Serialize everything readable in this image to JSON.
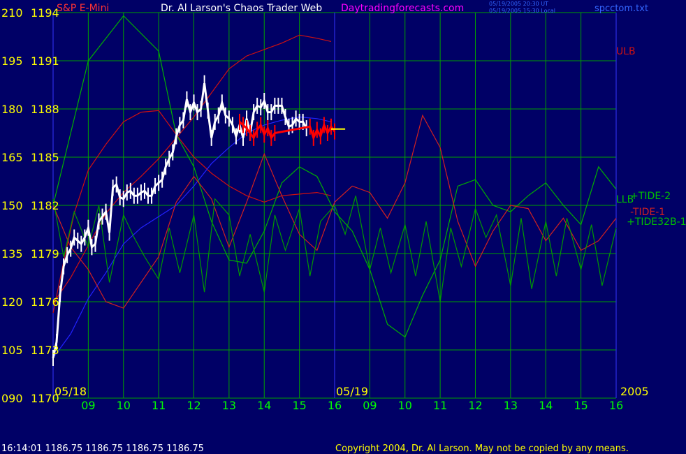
{
  "header": {
    "symbol": "S&P E-Mini",
    "title": "Dr. Al Larson's Chaos Trader Web",
    "site": "Daytradingforecasts.com",
    "time_utc": "05/19/2005 20:30 UT",
    "time_local": "05/19/2005 15:30 Local",
    "file": "spcctom.txt"
  },
  "footer": {
    "quote": "16:14:01  1186.75 1186.75 1186.75 1186.75",
    "copyright": "Copyright 2004, Dr. Al Larson. May not be copied by any means."
  },
  "colors": {
    "background": "#000066",
    "grid": "#00a000",
    "divider": "#3333ff",
    "axis_text": "#ffff00",
    "time_text": "#00ff00",
    "price": "#ffffff",
    "price_today": "#ff0000",
    "forecast": "#ffff00",
    "ulb_llb": "#d01010",
    "tide": "#00b000",
    "tide_label": "#00c000",
    "tide1": "#d02020",
    "tide32b": "#009900",
    "avg": "#2222ff",
    "header_red": "#ff3333",
    "header_white": "#ffffff",
    "header_magenta": "#ff00ff",
    "header_blue": "#3366ff",
    "footer_text": "#ffffff",
    "copyright_text": "#ffff00"
  },
  "chart_data": {
    "type": "line",
    "left_axis_labels": [
      {
        "osc": "210",
        "price": "1194"
      },
      {
        "osc": "195",
        "price": "1191"
      },
      {
        "osc": "180",
        "price": "1188"
      },
      {
        "osc": "165",
        "price": "1185"
      },
      {
        "osc": "150",
        "price": "1182"
      },
      {
        "osc": "135",
        "price": "1179"
      },
      {
        "osc": "120",
        "price": "1176"
      },
      {
        "osc": "105",
        "price": "1173"
      },
      {
        "osc": "090",
        "price": "1170"
      }
    ],
    "price_range": [
      1170,
      1194
    ],
    "osc_range": [
      90,
      210
    ],
    "x_range": [
      8.0,
      24.0
    ],
    "day_divider": 16.0,
    "date_labels": [
      {
        "text": "05/18",
        "x": 8.0
      },
      {
        "text": "05/19",
        "x": 16.0
      },
      {
        "text": "2005",
        "x": 24.0
      }
    ],
    "hour_ticks": [
      {
        "label": "09",
        "x": 9.0
      },
      {
        "label": "10",
        "x": 10.0
      },
      {
        "label": "11",
        "x": 11.0
      },
      {
        "label": "12",
        "x": 12.0
      },
      {
        "label": "13",
        "x": 13.0
      },
      {
        "label": "14",
        "x": 14.0
      },
      {
        "label": "15",
        "x": 15.0
      },
      {
        "label": "16",
        "x": 16.0
      },
      {
        "label": "09",
        "x": 17.0
      },
      {
        "label": "10",
        "x": 18.0
      },
      {
        "label": "11",
        "x": 19.0
      },
      {
        "label": "12",
        "x": 20.0
      },
      {
        "label": "13",
        "x": 21.0
      },
      {
        "label": "14",
        "x": 22.0
      },
      {
        "label": "15",
        "x": 23.0
      },
      {
        "label": "16",
        "x": 24.0
      }
    ],
    "series": [
      {
        "key": "ulb",
        "name": "ULB",
        "unit": "price",
        "label_pos": [
          24.0,
          1191.6
        ],
        "x": [
          8.0,
          8.5,
          9.0,
          9.5,
          10.0,
          10.5,
          11.0,
          11.5,
          12.0,
          12.5,
          13.0,
          13.5,
          14.0,
          14.5,
          15.0,
          15.5,
          15.9
        ],
        "values": [
          1175.9,
          1177.5,
          1179.5,
          1181.5,
          1182.8,
          1183.8,
          1184.9,
          1186.2,
          1187.5,
          1189.0,
          1190.5,
          1191.3,
          1191.7,
          1192.1,
          1192.6,
          1192.4,
          1192.2
        ]
      },
      {
        "key": "llb",
        "name": "LLB",
        "unit": "price",
        "label_pos": [
          24.0,
          1182.4
        ],
        "x": [
          8.0,
          8.3,
          8.6,
          9.0,
          9.5,
          10.0,
          10.5,
          11.0,
          11.5,
          12.0,
          12.5,
          13.0,
          13.5,
          14.0,
          14.5,
          15.0,
          15.5,
          15.9
        ],
        "values": [
          1175.3,
          1178.5,
          1181.5,
          1184.2,
          1185.8,
          1187.2,
          1187.8,
          1187.9,
          1186.4,
          1185.0,
          1184.0,
          1183.2,
          1182.6,
          1182.2,
          1182.6,
          1182.7,
          1182.8,
          1182.6
        ]
      },
      {
        "key": "avg",
        "name": "",
        "unit": "price",
        "label_pos": null,
        "x": [
          8.0,
          8.5,
          9.0,
          9.5,
          10.0,
          10.5,
          11.0,
          11.5,
          12.0,
          12.5,
          13.0,
          13.5,
          14.0,
          14.5,
          15.0,
          15.5,
          15.9
        ],
        "values": [
          1172.5,
          1174.0,
          1176.2,
          1177.8,
          1179.6,
          1180.6,
          1181.3,
          1182.0,
          1183.2,
          1184.6,
          1185.6,
          1186.5,
          1187.0,
          1187.3,
          1187.5,
          1187.4,
          1187.2
        ]
      },
      {
        "key": "tide2",
        "name": "+TIDE-2",
        "unit": "osc",
        "label_pos": [
          24.4,
          153
        ],
        "x": [
          8.0,
          9.0,
          10.0,
          11.0,
          11.5,
          12.0,
          12.5,
          13.0,
          13.5,
          14.0,
          14.5,
          15.0,
          15.5,
          16.0,
          16.5,
          17.0,
          17.5,
          18.0,
          18.5,
          19.0,
          19.5,
          20.0,
          20.5,
          21.0,
          21.5,
          22.0,
          22.5,
          23.0,
          23.5,
          24.0
        ],
        "values": [
          150,
          195,
          209,
          198,
          172,
          162,
          145,
          133,
          132,
          142,
          157,
          162,
          159,
          148,
          142,
          130,
          113,
          109,
          122,
          133,
          156,
          158,
          150,
          148,
          153,
          157,
          150,
          144,
          162,
          155
        ]
      },
      {
        "key": "tide1",
        "name": "-TIDE-1",
        "unit": "osc",
        "label_pos": [
          24.4,
          148
        ],
        "x": [
          8.0,
          8.5,
          9.0,
          9.5,
          10.0,
          10.5,
          11.0,
          11.5,
          12.0,
          12.5,
          13.0,
          13.5,
          14.0,
          14.5,
          15.0,
          15.5,
          16.0,
          16.5,
          17.0,
          17.5,
          18.0,
          18.5,
          19.0,
          19.5,
          20.0,
          20.5,
          21.0,
          21.5,
          22.0,
          22.5,
          23.0,
          23.5,
          24.0
        ],
        "values": [
          150,
          137,
          130,
          120,
          118,
          126,
          134,
          151,
          159,
          152,
          137,
          151,
          166,
          153,
          141,
          136,
          151,
          156,
          154,
          146,
          157,
          178,
          168,
          145,
          131,
          142,
          150,
          149,
          139,
          146,
          136,
          139,
          146
        ]
      },
      {
        "key": "tide32b",
        "name": "+TIDE32B-1",
        "unit": "osc",
        "label_pos": [
          24.3,
          145
        ],
        "x": [
          8.0,
          8.3,
          8.6,
          9.0,
          9.3,
          9.6,
          10.0,
          10.3,
          10.6,
          11.0,
          11.3,
          11.6,
          12.0,
          12.3,
          12.6,
          13.0,
          13.3,
          13.6,
          14.0,
          14.3,
          14.6,
          15.0,
          15.3,
          15.6,
          16.0,
          16.3,
          16.6,
          17.0,
          17.3,
          17.6,
          18.0,
          18.3,
          18.6,
          19.0,
          19.3,
          19.6,
          20.0,
          20.3,
          20.6,
          21.0,
          21.3,
          21.6,
          22.0,
          22.3,
          22.6,
          23.0,
          23.3,
          23.6,
          24.0
        ],
        "values": [
          152,
          134,
          148,
          137,
          150,
          126,
          147,
          140,
          134,
          127,
          143,
          129,
          147,
          123,
          152,
          147,
          128,
          141,
          123,
          147,
          136,
          149,
          128,
          145,
          150,
          141,
          153,
          130,
          143,
          129,
          144,
          128,
          145,
          120,
          143,
          131,
          149,
          140,
          147,
          125,
          146,
          124,
          145,
          128,
          146,
          130,
          144,
          125,
          143
        ]
      }
    ],
    "price_bars": {
      "x": [
        8.0,
        8.1,
        8.2,
        8.3,
        8.4,
        8.5,
        8.6,
        8.7,
        8.8,
        8.9,
        9.0,
        9.1,
        9.2,
        9.3,
        9.4,
        9.5,
        9.6,
        9.7,
        9.8,
        9.9,
        10.0,
        10.1,
        10.2,
        10.3,
        10.4,
        10.5,
        10.6,
        10.7,
        10.8,
        10.9,
        11.0,
        11.1,
        11.2,
        11.3,
        11.4,
        11.5,
        11.6,
        11.7,
        11.8,
        11.9,
        12.0,
        12.1,
        12.2,
        12.3,
        12.4,
        12.5,
        12.6,
        12.7,
        12.8,
        12.9,
        13.0,
        13.1,
        13.2,
        13.3,
        13.4,
        13.5,
        13.6,
        13.7,
        13.8,
        13.9,
        14.0,
        14.1,
        14.2,
        14.3,
        14.4,
        14.5,
        14.6,
        14.7,
        14.8,
        14.9,
        15.0,
        15.1,
        15.2
      ],
      "close": [
        1172.5,
        1173.5,
        1176.5,
        1178.2,
        1178.9,
        1179.3,
        1180.0,
        1179.8,
        1179.6,
        1180.0,
        1180.6,
        1179.4,
        1179.6,
        1181.0,
        1181.3,
        1181.6,
        1180.3,
        1183.1,
        1183.3,
        1182.5,
        1182.4,
        1182.8,
        1182.9,
        1182.6,
        1182.6,
        1182.8,
        1182.9,
        1182.6,
        1182.6,
        1183.2,
        1183.4,
        1183.6,
        1184.4,
        1184.9,
        1185.3,
        1186.3,
        1187.0,
        1187.3,
        1188.6,
        1187.8,
        1188.4,
        1187.8,
        1188.0,
        1189.6,
        1187.9,
        1186.2,
        1187.2,
        1187.6,
        1188.4,
        1187.6,
        1187.4,
        1187.0,
        1186.3,
        1187.0,
        1186.2,
        1187.4,
        1186.5,
        1187.8,
        1188.2,
        1188.1,
        1188.5,
        1187.8,
        1187.8,
        1188.2,
        1188.2,
        1188.2,
        1187.5,
        1186.9,
        1187.0,
        1187.4,
        1187.2,
        1187.2,
        1186.8
      ]
    },
    "today_bars": {
      "x": [
        13.3,
        13.4,
        13.5,
        13.6,
        13.7,
        13.8,
        13.9,
        14.0,
        14.1,
        14.2,
        14.3,
        15.3,
        15.4,
        15.5,
        15.6,
        15.7,
        15.8,
        15.9,
        16.0
      ],
      "close": [
        1187.2,
        1187.0,
        1186.8,
        1186.5,
        1186.2,
        1186.7,
        1187.0,
        1186.4,
        1186.8,
        1186.2,
        1186.5,
        1186.9,
        1186.2,
        1186.7,
        1186.3,
        1187.0,
        1186.5,
        1186.9,
        1186.6
      ]
    },
    "forecast_marks": {
      "x": [
        15.9,
        16.3
      ],
      "values": [
        1186.75,
        1186.75
      ]
    }
  }
}
